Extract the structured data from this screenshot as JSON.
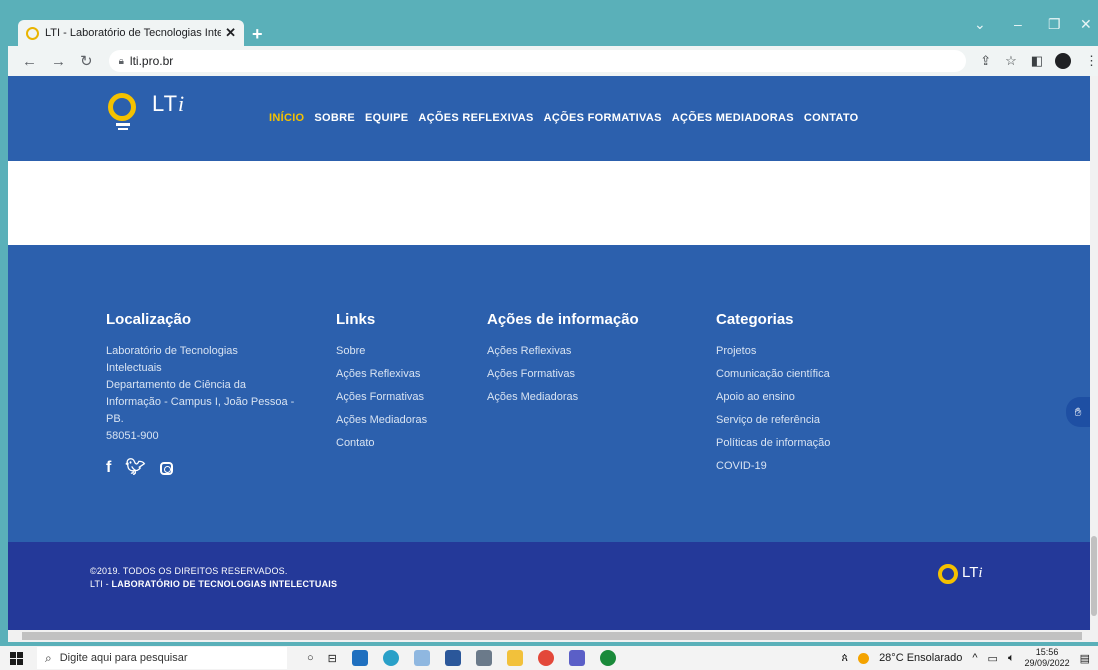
{
  "browser": {
    "tab_title": "LTI - Laboratório de Tecnologias Intelectuais",
    "tab_close": "✕",
    "new_tab": "+",
    "url": "lti.pro.br"
  },
  "site": {
    "logo_text": "LT",
    "logo_i": "i",
    "nav": [
      "INÍCIO",
      "SOBRE",
      "EQUIPE",
      "AÇÕES REFLEXIVAS",
      "AÇÕES FORMATIVAS",
      "AÇÕES MEDIADORAS",
      "CONTATO"
    ],
    "active_nav": "INÍCIO"
  },
  "footer": {
    "localizacao": {
      "heading": "Localização",
      "lines": [
        "Laboratório de Tecnologias",
        "Intelectuais",
        "Departamento de Ciência da",
        "Informação - Campus I, João Pessoa -",
        "PB.",
        "58051-900"
      ]
    },
    "links": {
      "heading": "Links",
      "items": [
        "Sobre",
        "Ações Reflexivas",
        "Ações Formativas",
        "Ações Mediadoras",
        "Contato"
      ]
    },
    "acoes": {
      "heading": "Ações de informação",
      "items": [
        "Ações Reflexivas",
        "Ações Formativas",
        "Ações Mediadoras"
      ]
    },
    "categorias": {
      "heading": "Categorias",
      "items": [
        "Projetos",
        "Comunicação científica",
        "Apoio ao ensino",
        "Serviço de referência",
        "Políticas de informação",
        "COVID-19"
      ]
    }
  },
  "copyright": {
    "line1": "©2019. TODOS OS DIREITOS RESERVADOS.",
    "line2_prefix": "LTI - ",
    "line2_bold": "LABORATÓRIO DE TECNOLOGIAS INTELECTUAIS"
  },
  "taskbar": {
    "search_placeholder": "Digite aqui para pesquisar",
    "weather": "28°C Ensolarado",
    "time": "15:56",
    "date": "29/09/2022"
  },
  "colors": {
    "header_blue": "#2c60ad",
    "bottom_blue": "#243999",
    "accent_yellow": "#f4c100"
  }
}
